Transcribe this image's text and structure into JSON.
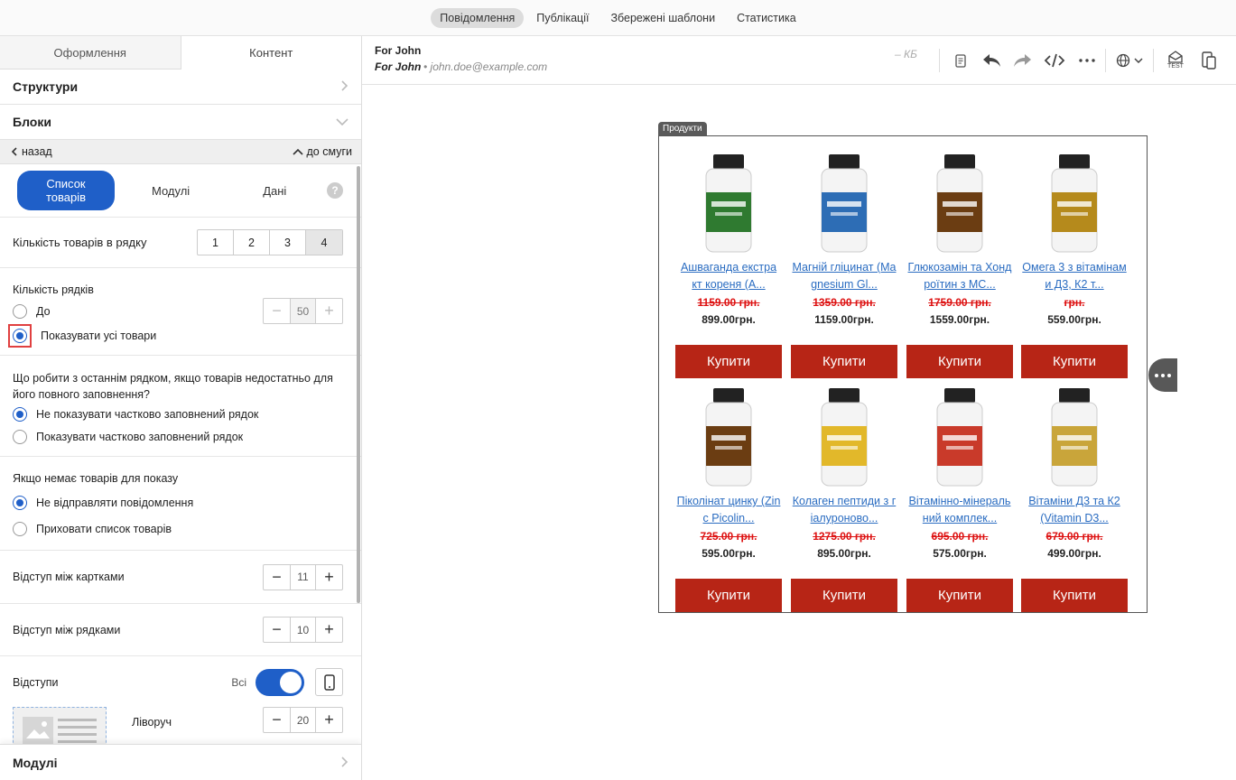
{
  "top_tabs": [
    {
      "label": "Повідомлення",
      "active": true
    },
    {
      "label": "Публікації"
    },
    {
      "label": "Збережені шаблони"
    },
    {
      "label": "Статистика"
    }
  ],
  "left": {
    "tabs": [
      "Оформлення",
      "Контент"
    ],
    "structures": "Структури",
    "blocks": "Блоки",
    "back": "назад",
    "to_strip": "до смуги",
    "subtabs": [
      "Список товарів",
      "Модулі",
      "Дані"
    ],
    "help": "?",
    "per_row_label": "Кількість товарів в рядку",
    "per_row_options": [
      "1",
      "2",
      "3",
      "4"
    ],
    "rows_label": "Кількість рядків",
    "rows_upto": "До",
    "rows_value": "50",
    "rows_show_all": "Показувати усі товари",
    "last_row_question": "Що робити з останнім рядком, якщо товарів недостатньо для його повного заповнення?",
    "last_row_opt1": "Не показувати частково заповнений рядок",
    "last_row_opt2": "Показувати частково заповнений рядок",
    "empty_label": "Якщо немає товарів для показу",
    "empty_opt1": "Не відправляти повідомлення",
    "empty_opt2": "Приховати список товарів",
    "card_gap_label": "Відступ між картками",
    "card_gap_value": "11",
    "row_gap_label": "Відступ між рядками",
    "row_gap_value": "10",
    "padding_label": "Відступи",
    "padding_all": "Всі",
    "left_label": "Ліворуч",
    "left_value": "20",
    "modules": "Модулі",
    "minus": "−",
    "plus": "+"
  },
  "header": {
    "from": "For John",
    "subject": "For John",
    "email": "• john.doe@example.com",
    "size": "– КБ",
    "test": "TEST"
  },
  "products": {
    "tag": "Продукти",
    "buy_label": "Купити",
    "items": [
      {
        "name1": "Ашваганда екстра",
        "name2": "кт кореня (A...",
        "old": "1159.00 грн.",
        "new": "899.00грн.",
        "color": "#2f7a30"
      },
      {
        "name1": "Магній гліцинат (Ma",
        "name2": "gnesium Gl...",
        "old": "1359.00 грн.",
        "new": "1159.00грн.",
        "color": "#2d6db5"
      },
      {
        "name1": "Глюкозамін та Хонд",
        "name2": "роїтин з MC...",
        "old": "1759.00 грн.",
        "new": "1559.00грн.",
        "color": "#6b3d12"
      },
      {
        "name1": "Омега 3 з вітамінам",
        "name2": "и Д3, К2 т...",
        "old": " грн.",
        "new": "559.00грн.",
        "color": "#b58a1c"
      },
      {
        "name1": "Піколінат цинку (Zin",
        "name2": "c Picolin...",
        "old": "725.00 грн.",
        "new": "595.00грн.",
        "color": "#6b3d12"
      },
      {
        "name1": "Колаген пептиди з г",
        "name2": "іалуроново...",
        "old": "1275.00 грн.",
        "new": "895.00грн.",
        "color": "#e2b82a"
      },
      {
        "name1": "Вітамінно-мінераль",
        "name2": "ний комплек...",
        "old": "695.00 грн.",
        "new": "575.00грн.",
        "color": "#c93a2a"
      },
      {
        "name1": "Вітаміни Д3 та К2",
        "name2": "(Vitamin D3...",
        "old": "679.00 грн.",
        "new": "499.00грн.",
        "color": "#c9a53a"
      }
    ]
  }
}
